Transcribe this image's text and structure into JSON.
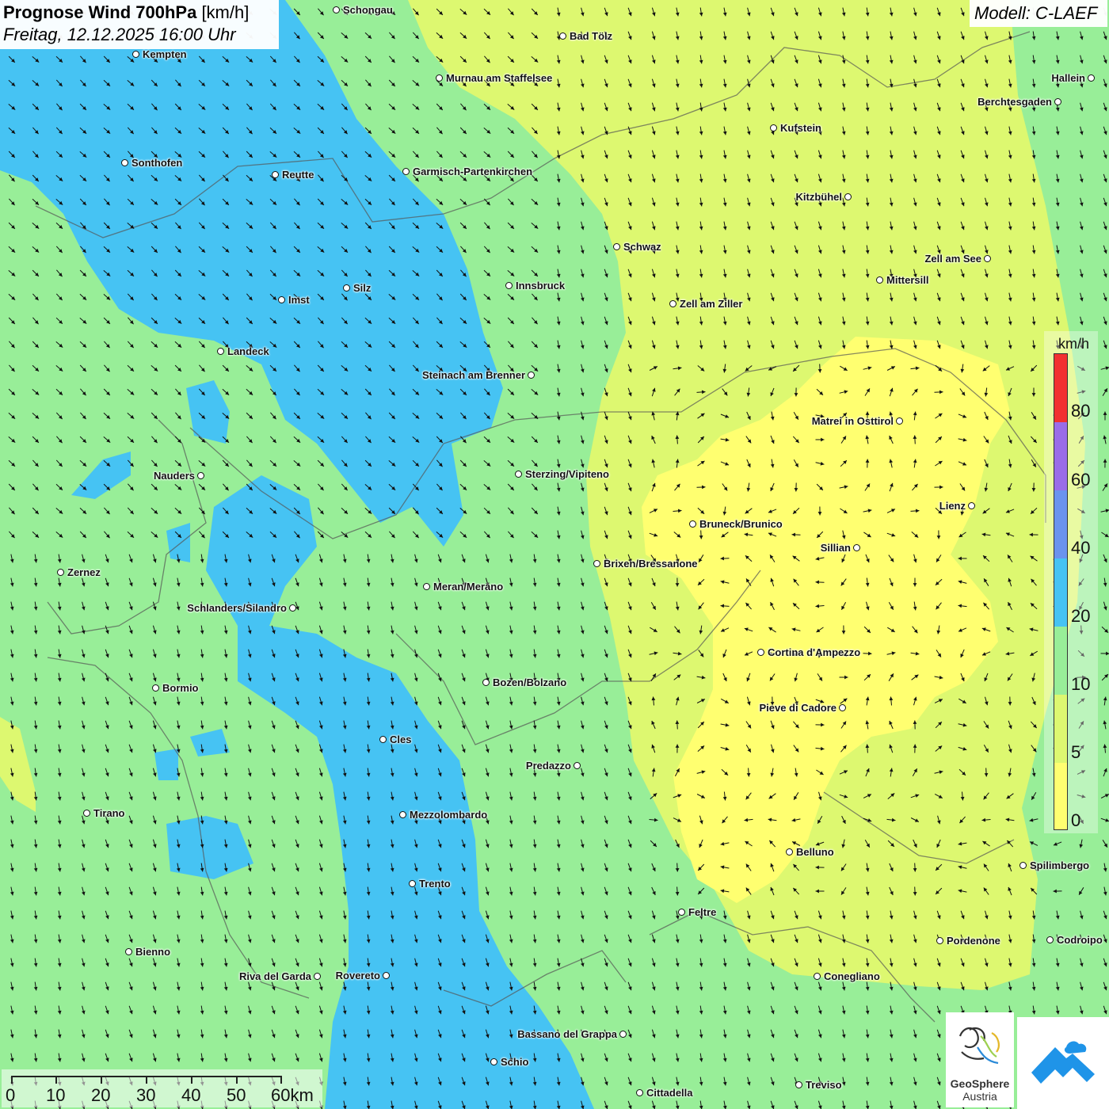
{
  "title": {
    "main": "Prognose Wind 700hPa",
    "unit": "[km/h]",
    "subtitle": "Freitag, 12.12.2025 16:00 Uhr"
  },
  "model": "Modell: C-LAEF",
  "colors": {
    "c0_5": "#ffff70",
    "c5_10": "#ddf870",
    "c10_20": "#98ee98",
    "c20_40": "#46c3f3",
    "c40_60": "#6a93ee",
    "c60_80": "#9a6ce8",
    "c80_plus": "#f23030",
    "roads_borders": "#555555"
  },
  "legend": {
    "unit": "km/h",
    "ticks": [
      "80",
      "60",
      "40",
      "20",
      "10",
      "5",
      "0"
    ]
  },
  "cities": [
    {
      "name": "Schongau"
    },
    {
      "name": "Bad Tölz"
    },
    {
      "name": "Kempten"
    },
    {
      "name": "Murnau am Staffelsee"
    },
    {
      "name": "Hallein"
    },
    {
      "name": "Berchtesgaden"
    },
    {
      "name": "Kufstein"
    },
    {
      "name": "Sonthofen"
    },
    {
      "name": "Reutte"
    },
    {
      "name": "Garmisch-Partenkirchen"
    },
    {
      "name": "Kitzbühel"
    },
    {
      "name": "Schwaz"
    },
    {
      "name": "Zell am See"
    },
    {
      "name": "Mittersill"
    },
    {
      "name": "Innsbruck"
    },
    {
      "name": "Silz"
    },
    {
      "name": "Imst"
    },
    {
      "name": "Zell am Ziller"
    },
    {
      "name": "Landeck"
    },
    {
      "name": "Steinach am Brenner"
    },
    {
      "name": "Matrei in Osttirol"
    },
    {
      "name": "Nauders"
    },
    {
      "name": "Sterzing/Vipiteno"
    },
    {
      "name": "Lienz"
    },
    {
      "name": "Bruneck/Brunico"
    },
    {
      "name": "Sillian"
    },
    {
      "name": "Brixen/Bressanone"
    },
    {
      "name": "Zernez"
    },
    {
      "name": "Meran/Merano"
    },
    {
      "name": "Schlanders/Silandro"
    },
    {
      "name": "Cortina d'Ampezzo"
    },
    {
      "name": "Bozen/Bolzano"
    },
    {
      "name": "Bormio"
    },
    {
      "name": "Pieve di Cadore"
    },
    {
      "name": "Cles"
    },
    {
      "name": "Predazzo"
    },
    {
      "name": "Tirano"
    },
    {
      "name": "Mezzolombardo"
    },
    {
      "name": "Belluno"
    },
    {
      "name": "Spilimbergo"
    },
    {
      "name": "Trento"
    },
    {
      "name": "Feltre"
    },
    {
      "name": "Pordenone"
    },
    {
      "name": "Codroipo"
    },
    {
      "name": "Bienno"
    },
    {
      "name": "Riva del Garda"
    },
    {
      "name": "Rovereto"
    },
    {
      "name": "Conegliano"
    },
    {
      "name": "Bassano del Grappa"
    },
    {
      "name": "Schio"
    },
    {
      "name": "Treviso"
    },
    {
      "name": "Cittadella"
    }
  ],
  "scalebar": {
    "labels": [
      "0",
      "10",
      "20",
      "30",
      "40",
      "50",
      "60km"
    ]
  },
  "logos": {
    "geosphere_line1": "GeoSphere",
    "geosphere_line2": "Austria"
  }
}
